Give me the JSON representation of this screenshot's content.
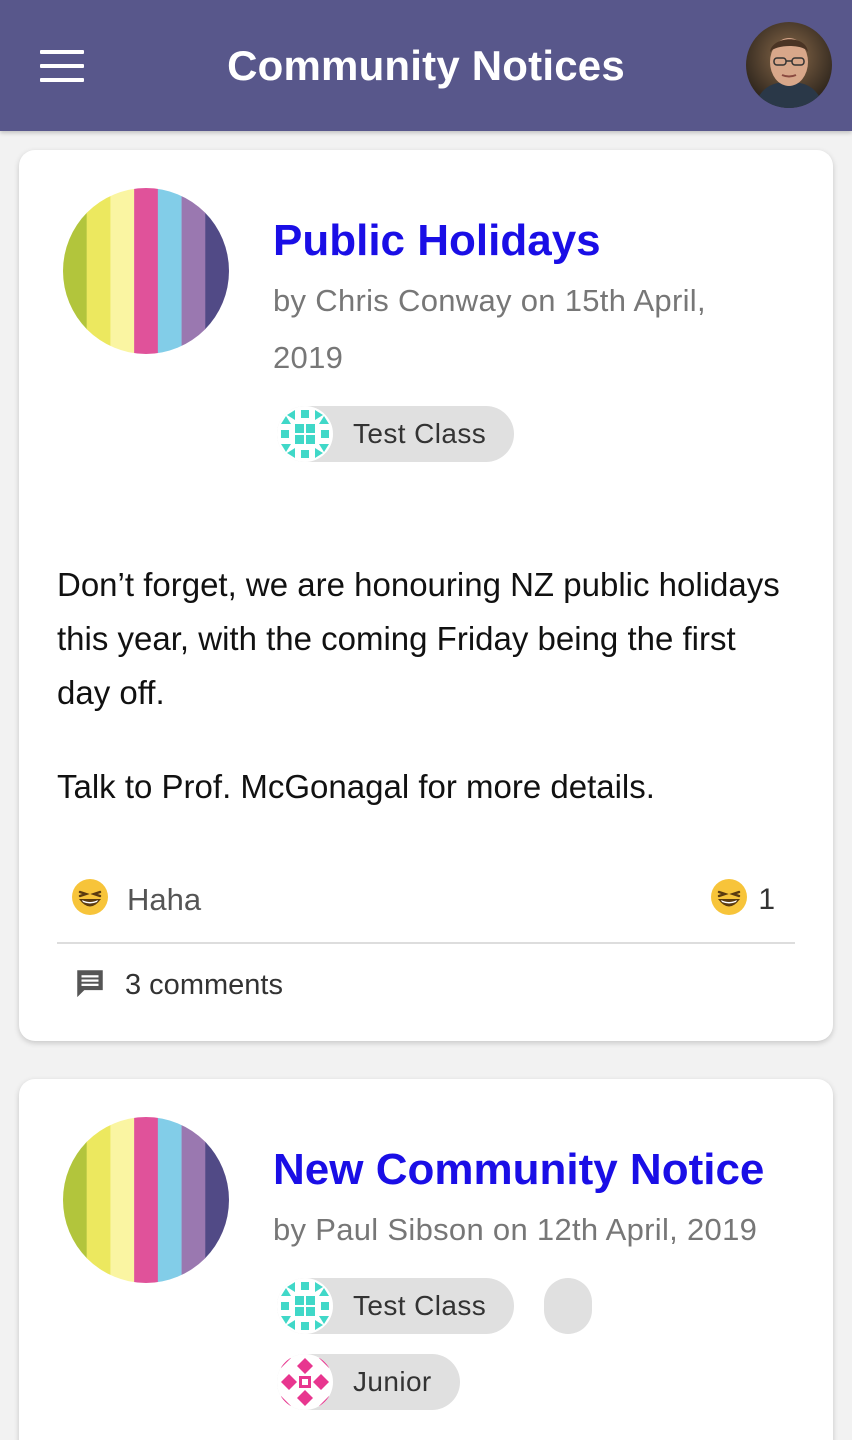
{
  "app": {
    "title": "Community Notices"
  },
  "header": {
    "menu_icon": "hamburger-menu-icon",
    "avatar_icon": "user-avatar"
  },
  "notices": [
    {
      "title": "Public Holidays",
      "byline": "by Chris Conway on 15th April, 2019",
      "tags": [
        {
          "label": "Test Class",
          "icon": "test-class-pattern-icon"
        }
      ],
      "body": [
        "Don’t forget, we are honouring NZ public holidays this year, with the coming Friday being the first day off.",
        "Talk to Prof. McGonagal for more details."
      ],
      "reaction_label": "Haha",
      "reaction_icon": "laughing-emoji-icon",
      "reaction_count": "1",
      "comments_label": "3 comments",
      "comments_icon": "comment-icon"
    },
    {
      "title": "New Community Notice",
      "byline": "by Paul Sibson on 12th April, 2019",
      "tags": [
        {
          "label": "Test Class",
          "icon": "test-class-pattern-icon"
        },
        {
          "label": "",
          "icon": "empty-tag-chip"
        },
        {
          "label": "Junior",
          "icon": "junior-pattern-icon"
        }
      ]
    }
  ],
  "colors": {
    "appbar": "#58578b",
    "title_link": "#1a0ee6",
    "stripes": [
      "#b2c53c",
      "#ece85f",
      "#faf5a2",
      "#e0529a",
      "#82cde8",
      "#9a78b0",
      "#514a86"
    ]
  }
}
